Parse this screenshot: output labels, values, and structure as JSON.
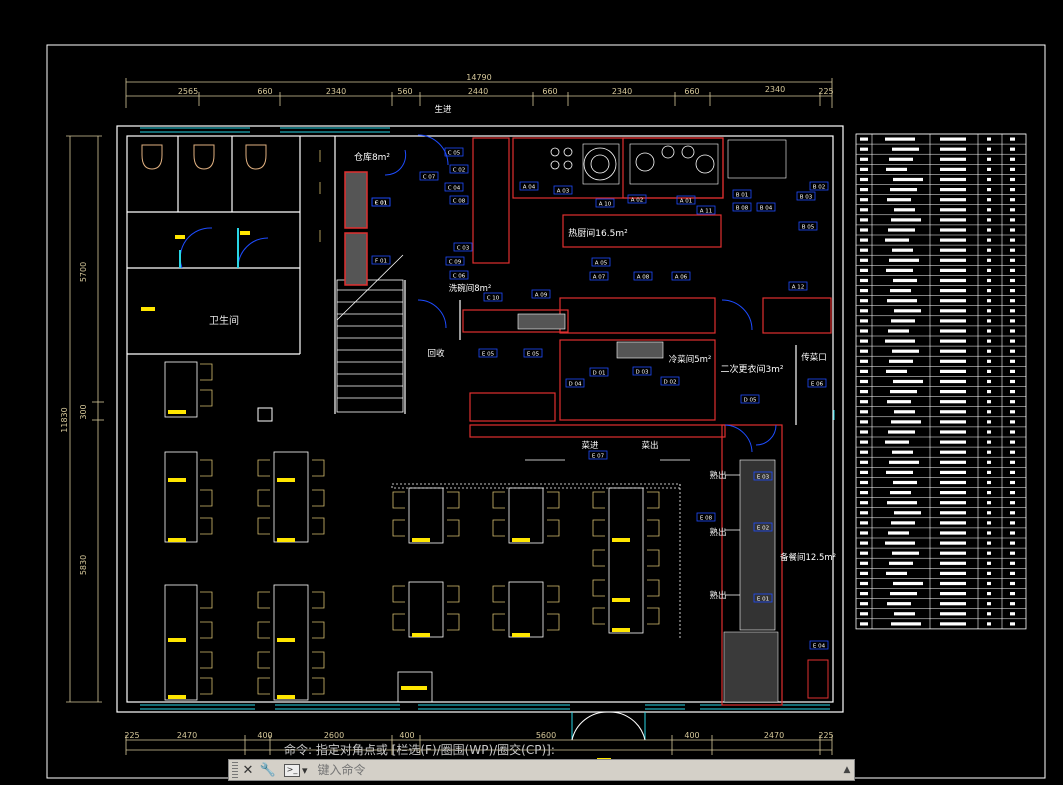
{
  "drawing": {
    "top_dims": {
      "total": "14790",
      "segments": [
        "2565",
        "660",
        "2340",
        "560",
        "2440",
        "660",
        "2340",
        "660",
        "2340",
        "225"
      ]
    },
    "bottom_dims": {
      "segments": [
        "225",
        "2470",
        "400",
        "2600",
        "400",
        "5600",
        "400",
        "2470",
        "225"
      ]
    },
    "left_dims": {
      "total": "11830",
      "segments": [
        "5700",
        "300",
        "5830"
      ]
    },
    "rooms": {
      "restroom": "卫生间",
      "storage": "仓库8m²",
      "hot_kitchen": "热厨间16.5m²",
      "wash_room": "洗碗间8m²",
      "cold_room": "冷菜间5m²",
      "second_change": "二次更衣间3m²",
      "pass_window": "传菜口",
      "recycle": "回收",
      "raw_in": "生进",
      "dish_in": "菜进",
      "dish_out": "菜出",
      "meal_out_1": "熟出",
      "meal_out_2": "熟出",
      "meal_out_3": "熟出",
      "serving_room": "备餐间12.5m²"
    },
    "equipment_tags": [
      "C 05",
      "C 02",
      "C 07",
      "C 04",
      "C 08",
      "C 01",
      "C 03",
      "C 06",
      "C 09",
      "C 10",
      "A 04",
      "A 03",
      "A 10",
      "A 02",
      "A 01",
      "A 11",
      "B 01",
      "B 08",
      "B 04",
      "B 03",
      "B 02",
      "B 05",
      "A 05",
      "A 07",
      "A 08",
      "A 06",
      "A 09",
      "A 12",
      "E 05",
      "E 05",
      "E 06",
      "D 04",
      "D 01",
      "D 03",
      "D 02",
      "D 05",
      "E 07",
      "E 03",
      "E 08",
      "E 02",
      "E 01",
      "E 04",
      "F 01",
      "F 01"
    ]
  },
  "command_history": "命令: 指定对角点或 [栏选(F)/圈围(WP)/圈交(CP)]:",
  "command_bar": {
    "placeholder": "键入命令",
    "close_icon": "close-icon",
    "customize_icon": "wrench-icon",
    "prompt_icon": "command-prompt-icon",
    "scroll_icon": "scroll-up-icon"
  },
  "colors": {
    "background": "#000000",
    "wall": "#ffffff",
    "kitchen_red": "#e03030",
    "door_blue": "#1e4cff",
    "window_cyan": "#29d6e6",
    "furniture_yellow": "#ffe600",
    "chair": "#d8c070",
    "frame": "#d6c89a"
  }
}
